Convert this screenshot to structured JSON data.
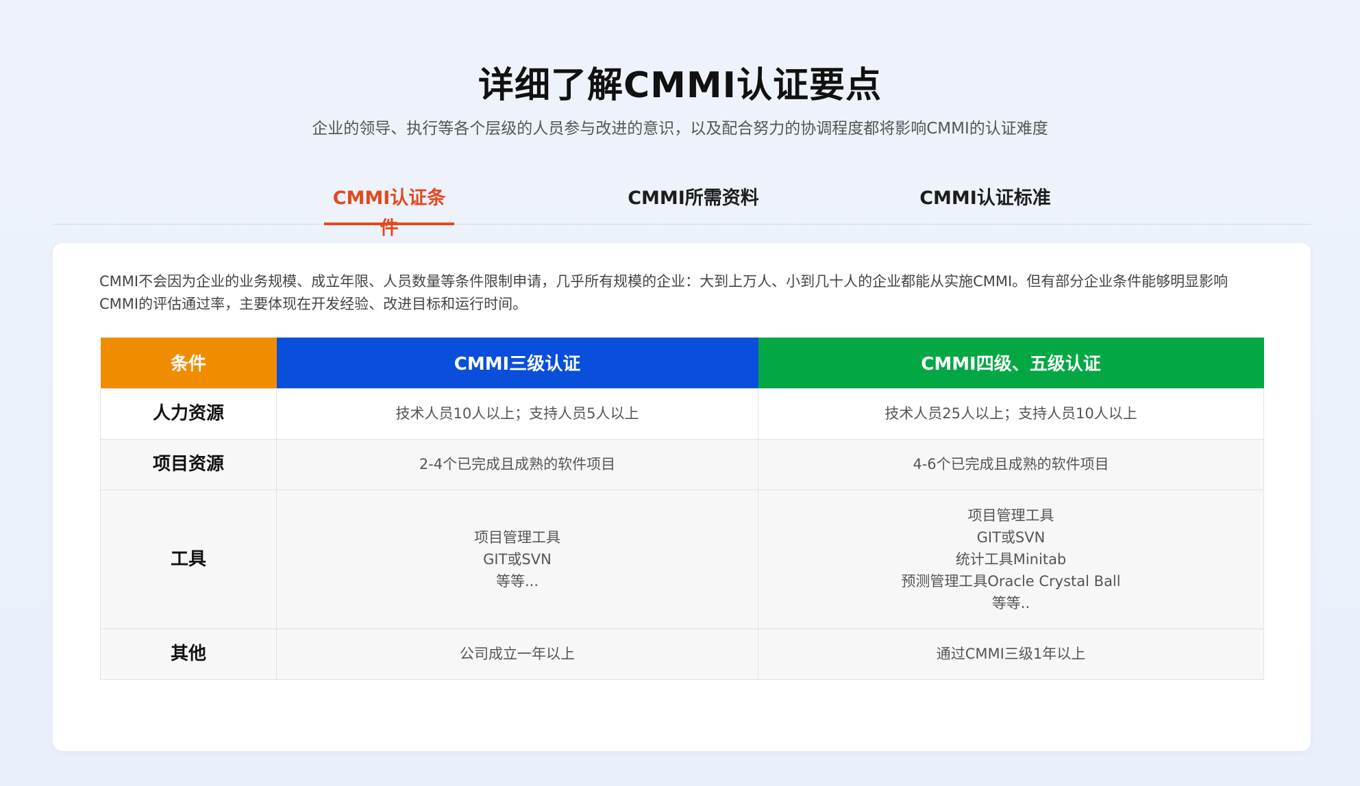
{
  "header": {
    "title": "详细了解CMMI认证要点",
    "subtitle": "企业的领导、执行等各个层级的人员参与改进的意识，以及配合努力的协调程度都将影响CMMI的认证难度"
  },
  "tabs": [
    {
      "label": "CMMI认证条件",
      "active": true
    },
    {
      "label": "CMMI所需资料",
      "active": false
    },
    {
      "label": "CMMI认证标准",
      "active": false
    }
  ],
  "content": {
    "intro": "CMMI不会因为企业的业务规模、成立年限、人员数量等条件限制申请，几乎所有规模的企业：大到上万人、小到几十人的企业都能从实施CMMI。但有部分企业条件能够明显影响CMMI的评估通过率，主要体现在开发经验、改进目标和运行时间。",
    "table": {
      "headers": [
        "条件",
        "CMMI三级认证",
        "CMMI四级、五级认证"
      ],
      "rows": [
        {
          "label": "人力资源",
          "level3": [
            "技术人员10人以上；支持人员5人以上"
          ],
          "level45": [
            "技术人员25人以上；支持人员10人以上"
          ]
        },
        {
          "label": "项目资源",
          "level3": [
            "2-4个已完成且成熟的软件项目"
          ],
          "level45": [
            "4-6个已完成且成熟的软件项目"
          ]
        },
        {
          "label": "工具",
          "level3": [
            "项目管理工具",
            "GIT或SVN",
            "等等..."
          ],
          "level45": [
            "项目管理工具",
            "GIT或SVN",
            "统计工具Minitab",
            "预测管理工具Oracle Crystal Ball",
            "等等.."
          ]
        },
        {
          "label": "其他",
          "level3": [
            "公司成立一年以上"
          ],
          "level45": [
            "通过CMMI三级1年以上"
          ]
        }
      ]
    }
  },
  "colors": {
    "accent": "#e4491b",
    "header_condition": "#f08c00",
    "header_level3": "#0a4fdb",
    "header_level45": "#03a845"
  }
}
